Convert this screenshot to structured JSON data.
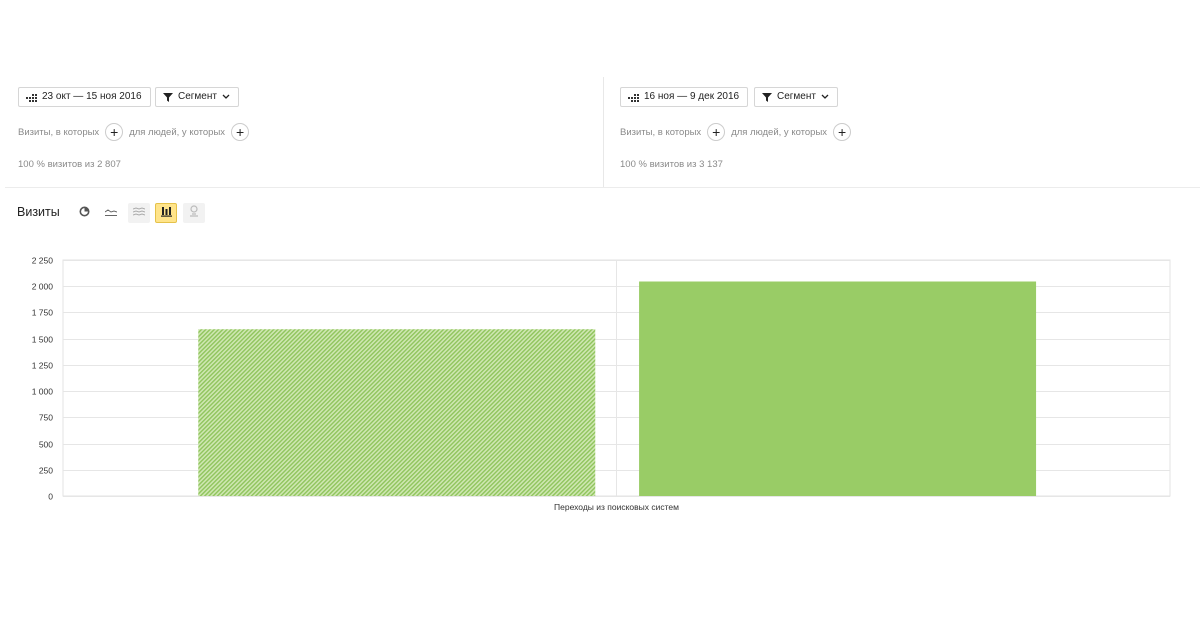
{
  "left_panel": {
    "date_range": "23 окт — 15 ноя 2016",
    "segment_label": "Сегмент",
    "visits_where": "Визиты, в которых",
    "people_where": "для людей, у которых",
    "percent_text": "100 % визитов из 2 807"
  },
  "right_panel": {
    "date_range": "16 ноя — 9 дек 2016",
    "segment_label": "Сегмент",
    "visits_where": "Визиты, в которых",
    "people_where": "для людей, у которых",
    "percent_text": "100 % визитов из 3 137"
  },
  "metric": {
    "title": "Визиты",
    "view_icons": [
      "pie-chart-icon",
      "line-chart-icon",
      "area-chart-icon",
      "bar-chart-icon",
      "map-icon"
    ],
    "active_view": "bar-chart-icon"
  },
  "colors": {
    "bar": "#99cc66",
    "active_button_bg": "#ffe48a"
  },
  "chart_data": {
    "type": "bar",
    "categories": [
      "Переходы из поисковых систем"
    ],
    "series": [
      {
        "values": [
          1590
        ],
        "color": "#99cc66",
        "pattern": "hatched"
      },
      {
        "values": [
          2045
        ],
        "color": "#99cc66",
        "pattern": "solid"
      }
    ],
    "ylim": [
      0,
      2250
    ],
    "yticks": [
      0,
      250,
      500,
      750,
      1000,
      1250,
      1500,
      1750,
      2000,
      2250
    ],
    "ytick_labels": [
      "0",
      "250",
      "500",
      "750",
      "1 000",
      "1 250",
      "1 500",
      "1 750",
      "2 000",
      "2 250"
    ],
    "grid": true,
    "legend": "none"
  }
}
